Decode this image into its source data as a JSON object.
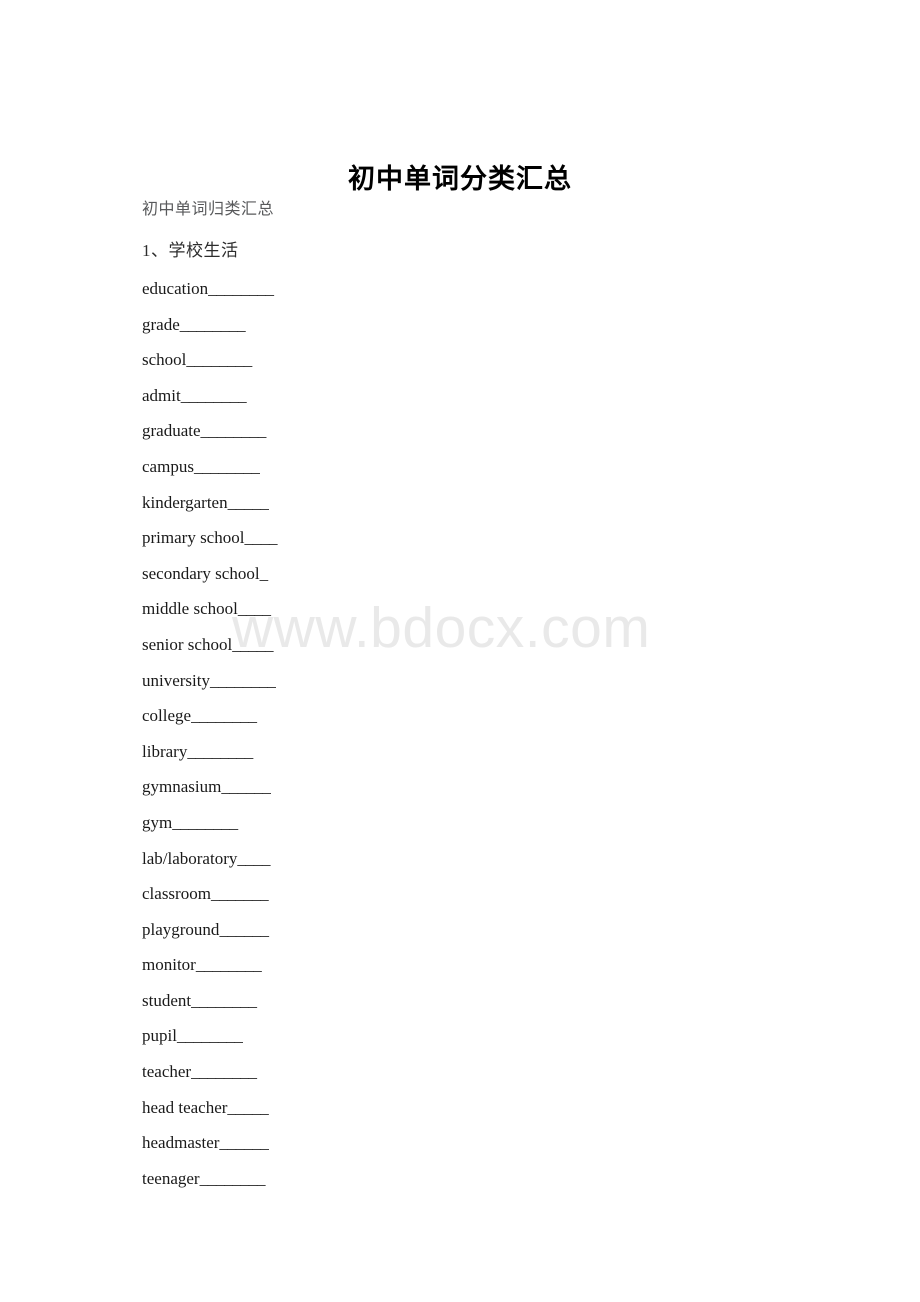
{
  "document": {
    "title": "初中单词分类汇总",
    "subtitle": "初中单词归类汇总",
    "section_heading": "1、学校生活",
    "watermark": "www.bdocx.com",
    "colors": {
      "page_background": "#ffffff",
      "title_text": "#000000",
      "body_text": "#1a1a1a",
      "subtitle_text": "#58595b",
      "watermark_text": "#e9e9e9"
    }
  },
  "entries": [
    {
      "term": "education",
      "blank": "________"
    },
    {
      "term": "grade",
      "blank": "________"
    },
    {
      "term": "school",
      "blank": "________"
    },
    {
      "term": "admit",
      "blank": "________"
    },
    {
      "term": "graduate",
      "blank": "________"
    },
    {
      "term": "campus",
      "blank": "________"
    },
    {
      "term": "kindergarten",
      "blank": "_____"
    },
    {
      "term": "primary school",
      "blank": "____"
    },
    {
      "term": "secondary school",
      "blank": "_"
    },
    {
      "term": "middle school",
      "blank": "____"
    },
    {
      "term": "senior school",
      "blank": "_____"
    },
    {
      "term": "university",
      "blank": "________"
    },
    {
      "term": "college",
      "blank": "________"
    },
    {
      "term": "library",
      "blank": "________"
    },
    {
      "term": "gymnasium",
      "blank": "______"
    },
    {
      "term": "gym",
      "blank": "________"
    },
    {
      "term": "lab/laboratory",
      "blank": "____"
    },
    {
      "term": "classroom",
      "blank": "_______"
    },
    {
      "term": "playground",
      "blank": "______"
    },
    {
      "term": "monitor",
      "blank": "________"
    },
    {
      "term": "student",
      "blank": "________"
    },
    {
      "term": "pupil",
      "blank": "________"
    },
    {
      "term": "teacher",
      "blank": "________"
    },
    {
      "term": "head teacher",
      "blank": "_____"
    },
    {
      "term": "headmaster",
      "blank": "______"
    },
    {
      "term": "teenager",
      "blank": "________"
    }
  ]
}
